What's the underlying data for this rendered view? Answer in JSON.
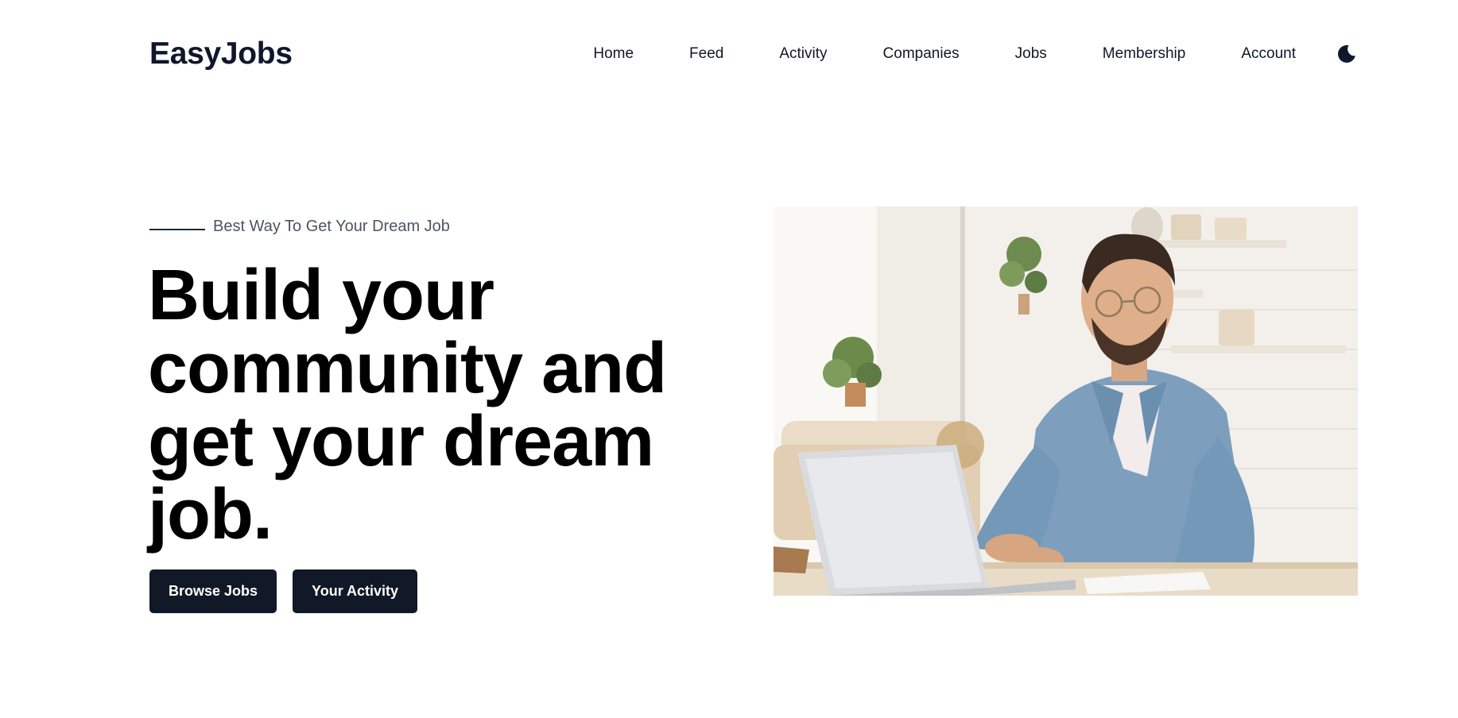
{
  "header": {
    "logo": "EasyJobs",
    "nav": [
      {
        "label": "Home"
      },
      {
        "label": "Feed"
      },
      {
        "label": "Activity"
      },
      {
        "label": "Companies"
      },
      {
        "label": "Jobs"
      },
      {
        "label": "Membership"
      },
      {
        "label": "Account"
      }
    ],
    "theme_toggle_icon": "moon-icon"
  },
  "hero": {
    "eyebrow": "Best Way To Get Your Dream Job",
    "headline_lines": [
      "Build your",
      "community and",
      "get your dream",
      "job."
    ],
    "buttons": {
      "browse": "Browse Jobs",
      "activity": "Your Activity"
    },
    "image_subject": "photo-man-at-laptop"
  },
  "colors": {
    "primary": "#111827",
    "text": "#0f172a",
    "muted": "#4b5563",
    "background": "#ffffff"
  }
}
